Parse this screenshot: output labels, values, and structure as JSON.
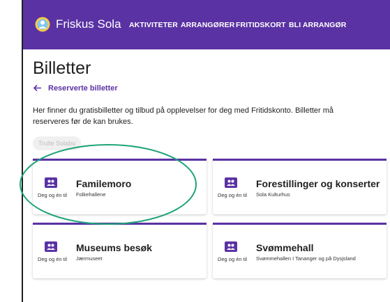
{
  "navbar": {
    "brand": "Friskus Sola",
    "links": [
      "AKTIVITETER",
      "ARRANGØRER",
      "FRITIDSKORT",
      "BLI ARRANGØR"
    ],
    "bg_color": "#5a32a3"
  },
  "page": {
    "title": "Billetter",
    "back_link": "Reserverte billetter",
    "intro": "Her finner du gratisbilletter og tilbud på opplevelser for deg med Fritidskonto. Billetter må reserveres før de kan brukes.",
    "chip": "Trulte Solabu"
  },
  "cards": [
    {
      "title": "Familemoro",
      "subtitle": "Folkehallene",
      "label": "Deg og én til",
      "icon": "people-icon"
    },
    {
      "title": "Forestillinger og konserter",
      "subtitle": "Sola Kulturhus",
      "label": "Deg og én til",
      "icon": "people-icon"
    },
    {
      "title": "Museums besøk",
      "subtitle": "Jærmuseet",
      "label": "Deg og én til",
      "icon": "people-icon"
    },
    {
      "title": "Svømmehall",
      "subtitle": "Svømmehallen I Tananger og på Dysjsland",
      "label": "Deg og én til",
      "icon": "people-icon"
    }
  ],
  "colors": {
    "accent": "#5a32a3",
    "annotation": "#1fa37a"
  }
}
